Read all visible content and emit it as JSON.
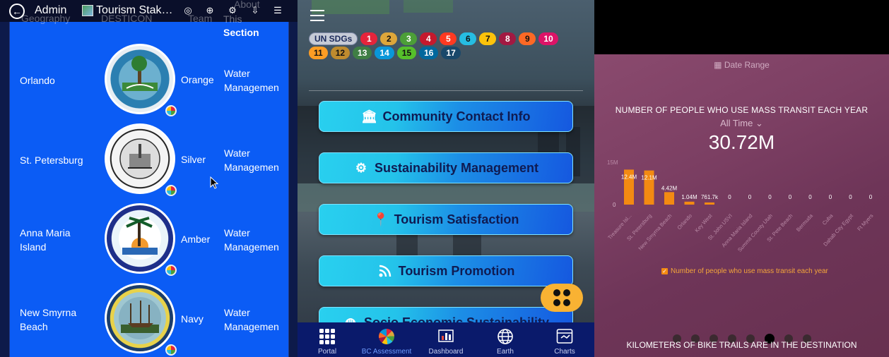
{
  "left": {
    "topbar": {
      "admin_label": "Admin",
      "title": "Tourism Stak…",
      "ghost_geography": "Geography",
      "ghost_desticon": "DESTICON",
      "ghost_team": "Team",
      "ghost_about": "About",
      "ghost_this": "This"
    },
    "section_header": "Section",
    "rows": [
      {
        "city": "Orlando",
        "seal_text": "CITY OF ORLANDO FLORIDA",
        "seal_sub": "THE CITY BEAUTIFUL",
        "color": "Orange",
        "area": "Water Managemen"
      },
      {
        "city": "St. Petersburg",
        "seal_text": "CITY OF ST. PETERSBURG",
        "seal_sub": "INCORPORATED",
        "color": "Silver",
        "area": "Water Managemen"
      },
      {
        "city": "Anna Maria Island",
        "seal_text": "CITY OF ANNA MARIA",
        "seal_sub": "MANATEE COUNTY FLORIDA",
        "color": "Amber",
        "area": "Water Managemen"
      },
      {
        "city": "New Smyrna Beach",
        "seal_text": "NEW SMYRNA",
        "seal_sub": "BEACH",
        "color": "Navy",
        "area": "Water Managemen"
      }
    ]
  },
  "mid": {
    "sdg_label": "UN SDGs",
    "sdgs_row1": [
      {
        "n": "1",
        "c": "#e5243b"
      },
      {
        "n": "2",
        "c": "#dda63a"
      },
      {
        "n": "3",
        "c": "#4c9f38"
      },
      {
        "n": "4",
        "c": "#c5192d"
      },
      {
        "n": "5",
        "c": "#ff3a21"
      },
      {
        "n": "6",
        "c": "#26bde2"
      },
      {
        "n": "7",
        "c": "#fcc30b"
      },
      {
        "n": "8",
        "c": "#a21942"
      },
      {
        "n": "9",
        "c": "#fd6925"
      },
      {
        "n": "10",
        "c": "#dd1367"
      }
    ],
    "sdgs_row2": [
      {
        "n": "11",
        "c": "#fd9d24"
      },
      {
        "n": "12",
        "c": "#bf8b2e"
      },
      {
        "n": "13",
        "c": "#3f7e44"
      },
      {
        "n": "14",
        "c": "#0a97d9"
      },
      {
        "n": "15",
        "c": "#56c02b"
      },
      {
        "n": "16",
        "c": "#00689d"
      },
      {
        "n": "17",
        "c": "#19486a"
      }
    ],
    "buttons": [
      {
        "label": "Community Contact Info",
        "icon": "building-icon"
      },
      {
        "label": "Sustainability Management",
        "icon": "gears-icon"
      },
      {
        "label": "Tourism Satisfaction",
        "icon": "location-pin-icon"
      },
      {
        "label": "Tourism Promotion",
        "icon": "rss-icon"
      },
      {
        "label": "Socio Economic Sustainability",
        "icon": "globe-icon"
      }
    ],
    "nav": [
      {
        "label": "Portal",
        "icon": "grid-icon"
      },
      {
        "label": "BC Assessment",
        "icon": "sdg-wheel-icon",
        "active": true
      },
      {
        "label": "Dashboard",
        "icon": "chart-icon"
      },
      {
        "label": "Earth",
        "icon": "globe-icon"
      },
      {
        "label": "Charts",
        "icon": "charts-icon"
      }
    ]
  },
  "right": {
    "date_range": "Date Range",
    "chart_title": "NUMBER OF PEOPLE WHO USE MASS TRANSIT EACH YEAR",
    "all_time": "All Time",
    "big_number": "30.72M",
    "legend_label": "Number of people who use mass transit each year",
    "next_chart_title": "KILOMETERS OF BIKE TRAILS ARE IN THE DESTINATION",
    "bar_color": "#f38a12",
    "dots_count": 8,
    "active_dot": 5
  },
  "chart_data": {
    "type": "bar",
    "title": "NUMBER OF PEOPLE WHO USE MASS TRANSIT EACH YEAR",
    "ylim": [
      0,
      15000000
    ],
    "y_top_tick": "15M",
    "y_zero_tick": "0",
    "categories": [
      "Treasure Isl...",
      "St. Petersburg",
      "New Smyrna Beach",
      "Orlando",
      "Key West",
      "St. John USVI",
      "Anna Maria Island",
      "Summit County Utah",
      "St. Pete Beach",
      "Bermuda",
      "Cuba",
      "Dahab City Egypt",
      "Ft Myers"
    ],
    "series": [
      {
        "name": "Number of people who use mass transit each year",
        "values": [
          12400000,
          12100000,
          4420000,
          1040000,
          761700,
          0,
          0,
          0,
          0,
          0,
          0,
          0,
          0
        ],
        "labels": [
          "12.4M",
          "12.1M",
          "4.42M",
          "1.04M",
          "761.7k",
          "0",
          "0",
          "0",
          "0",
          "0",
          "0",
          "0",
          "0"
        ]
      }
    ]
  }
}
